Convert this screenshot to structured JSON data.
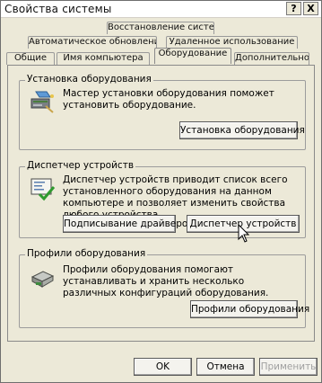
{
  "window": {
    "title": "Свойства системы",
    "help_label": "?",
    "close_label": "X"
  },
  "tabs": {
    "row1": [
      "Восстановление системы"
    ],
    "row2": [
      "Автоматическое обновление",
      "Удаленное использование"
    ],
    "row3": [
      "Общие",
      "Имя компьютера",
      "Оборудование",
      "Дополнительно"
    ],
    "active": "Оборудование"
  },
  "groups": [
    {
      "title": "Установка оборудования",
      "icon": "hardware-wizard-icon",
      "text": "Мастер установки оборудования поможет установить оборудование.",
      "buttons": [
        "Установка оборудования"
      ]
    },
    {
      "title": "Диспетчер устройств",
      "icon": "device-manager-icon",
      "text": "Диспетчер устройств приводит список всего установленного оборудования на данном компьютере и позволяет изменить свойства любого устройства.",
      "buttons": [
        "Подписывание драйверов",
        "Диспетчер устройств"
      ]
    },
    {
      "title": "Профили оборудования",
      "icon": "hardware-profiles-icon",
      "text": "Профили оборудования помогают устанавливать и хранить несколько различных конфигураций оборудования.",
      "buttons": [
        "Профили оборудования"
      ]
    }
  ],
  "footer": {
    "ok_label": "OK",
    "cancel_label": "Отмена",
    "apply_label": "Применить"
  }
}
